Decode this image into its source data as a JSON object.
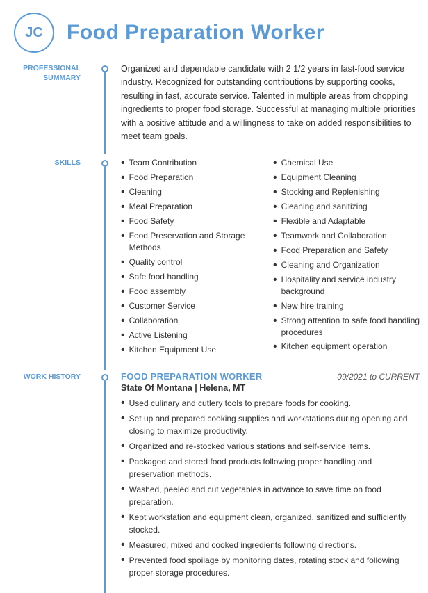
{
  "header": {
    "initials": "JC",
    "job_title": "Food Preparation Worker"
  },
  "professional_summary": {
    "label_line1": "PROFESSIONAL",
    "label_line2": "SUMMARY",
    "text": "Organized and dependable candidate with 2 1/2 years in fast-food service industry. Recognized for outstanding contributions by supporting cooks, resulting in fast, accurate service. Talented in multiple areas from chopping ingredients to proper food storage. Successful at managing multiple priorities with a positive attitude and a willingness to take on added responsibilities to meet team goals."
  },
  "skills": {
    "label": "SKILLS",
    "left_col": [
      "Team Contribution",
      "Food Preparation",
      "Cleaning",
      "Meal Preparation",
      "Food Safety",
      "Food Preservation and Storage Methods",
      "Quality control",
      "Safe food handling",
      "Food assembly",
      "Customer Service",
      "Collaboration",
      "Active Listening",
      "Kitchen Equipment Use"
    ],
    "right_col": [
      "Chemical Use",
      "Equipment Cleaning",
      "Stocking and Replenishing",
      "Cleaning and sanitizing",
      "Flexible and Adaptable",
      "Teamwork and Collaboration",
      "Food Preparation and Safety",
      "Cleaning and Organization",
      "Hospitality and service industry background",
      "New hire training",
      "Strong attention to safe food handling procedures",
      "Kitchen equipment operation"
    ]
  },
  "work_history": {
    "label": "WORK HISTORY",
    "job_title": "FOOD PREPARATION WORKER",
    "dates": "09/2021 to CURRENT",
    "employer": "State Of Montana | Helena, MT",
    "bullets": [
      "Used culinary and cutlery tools to prepare foods for cooking.",
      "Set up and prepared cooking supplies and workstations during opening and closing to maximize productivity.",
      "Organized and re-stocked various stations and self-service items.",
      "Packaged and stored food products following proper handling and preservation methods.",
      "Washed, peeled and cut vegetables in advance to save time on food preparation.",
      "Kept workstation and equipment clean, organized, sanitized and sufficiently stocked.",
      "Measured, mixed and cooked ingredients following directions.",
      "Prevented food spoilage by monitoring dates, rotating stock and following proper storage procedures."
    ]
  }
}
